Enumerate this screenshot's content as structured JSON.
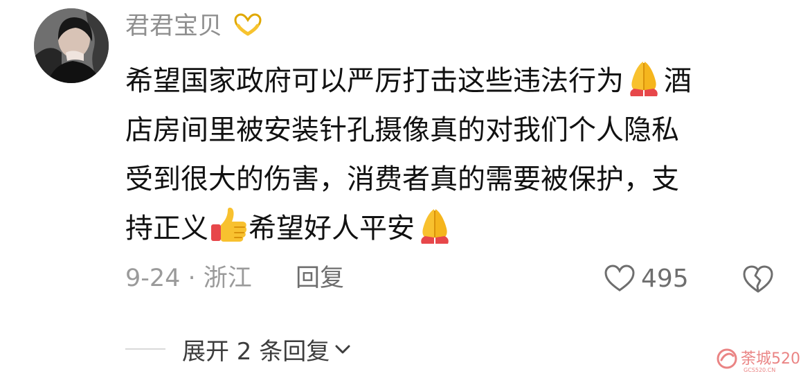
{
  "comment": {
    "username": "君君宝贝",
    "username_emoji": "heart-hands-emoji",
    "lines": [
      {
        "parts": [
          {
            "text": "希望国家政府可以严厉打击这些违法行为"
          },
          {
            "emoji": "folded-hands"
          },
          {
            "text": "酒"
          }
        ]
      },
      {
        "parts": [
          {
            "text": "店房间里被安装针孔摄像真的对我们个人隐私"
          }
        ]
      },
      {
        "parts": [
          {
            "text": "受到很大的伤害，消费者真的需要被保护，支"
          }
        ]
      },
      {
        "parts": [
          {
            "text": "持正义"
          },
          {
            "emoji": "thumbs-up"
          },
          {
            "text": "希望好人平安"
          },
          {
            "emoji": "folded-hands"
          }
        ]
      }
    ],
    "meta": "9-24 · 浙江",
    "reply_label": "回复",
    "like_count": "495",
    "expand_label": "展开 2 条回复"
  },
  "watermark": {
    "text": "荼城520",
    "subtext": "GCS520.CN"
  },
  "colors": {
    "username": "#8f8f8f",
    "body": "#111111",
    "meta": "#9a9a9a",
    "action": "#6e6e6e",
    "emoji_yellow": "#f8c12f",
    "emoji_red": "#e7474a",
    "watermark_red": "#e35b5b"
  }
}
